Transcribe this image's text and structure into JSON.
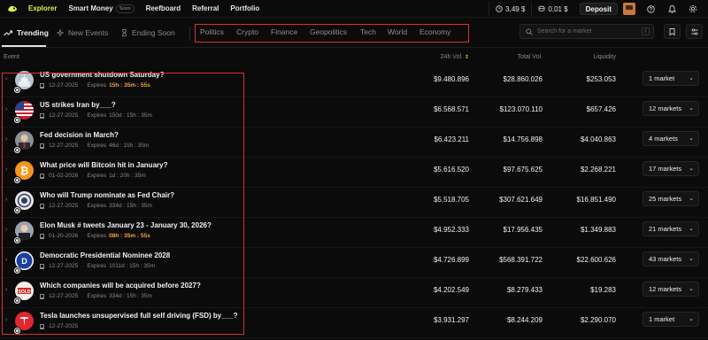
{
  "nav": {
    "links": [
      "Explorer",
      "Smart Money",
      "Reefboard",
      "Referral",
      "Portfolio"
    ],
    "soon_badge": "Soon",
    "balance_1": "3,49 $",
    "balance_2": "0,01 $",
    "deposit_label": "Deposit"
  },
  "tabs": {
    "trending": "Trending",
    "new_events": "New Events",
    "ending_soon": "Ending Soon"
  },
  "categories": [
    "Politics",
    "Crypto",
    "Finance",
    "Geopolitics",
    "Tech",
    "World",
    "Economy"
  ],
  "search": {
    "placeholder": "Search for a market",
    "shortcut": "/"
  },
  "columns": {
    "event": "Event",
    "vol_24h": "24h Vol.",
    "total_vol": "Total Vol.",
    "liquidity": "Liquidity"
  },
  "colors": {
    "accent": "#d7f24a",
    "highlight_box": "#d9312f",
    "expires_hot": "#f2a43a"
  },
  "rows": [
    {
      "title": "US government shutdown Saturday?",
      "date": "12-27-2025",
      "expires": "15h : 35m : 55s",
      "expires_hot": true,
      "vol_24h": "$9.480.896",
      "total_vol": "$28.860.026",
      "liquidity": "$253.053",
      "markets": "1 market",
      "icon": "capitol-icon"
    },
    {
      "title": "US strikes Iran by___?",
      "date": "12-27-2025",
      "expires": "150d : 15h : 35m",
      "expires_hot": false,
      "vol_24h": "$6.568.571",
      "total_vol": "$123.070.110",
      "liquidity": "$657.426",
      "markets": "12 markets",
      "icon": "us-flag-icon"
    },
    {
      "title": "Fed decision in March?",
      "date": "12-27-2025",
      "expires": "46d : 15h : 35m",
      "expires_hot": false,
      "vol_24h": "$6.423.211",
      "total_vol": "$14.756.898",
      "liquidity": "$4.040.863",
      "markets": "4 markets",
      "icon": "fed-chair-icon"
    },
    {
      "title": "What price will Bitcoin hit in January?",
      "date": "01-02-2026",
      "expires": "1d : 20h : 35m",
      "expires_hot": false,
      "vol_24h": "$5.616.520",
      "total_vol": "$97.675.625",
      "liquidity": "$2.268.221",
      "markets": "17 markets",
      "icon": "bitcoin-icon"
    },
    {
      "title": "Who will Trump nominate as Fed Chair?",
      "date": "12-27-2025",
      "expires": "334d : 15h : 35m",
      "expires_hot": false,
      "vol_24h": "$5.518.705",
      "total_vol": "$307.621.649",
      "liquidity": "$16.851.490",
      "markets": "25 markets",
      "icon": "fed-seal-icon"
    },
    {
      "title": "Elon Musk # tweets January 23 - January 30, 2026?",
      "date": "01-20-2026",
      "expires": "08h : 35m : 55s",
      "expires_hot": true,
      "vol_24h": "$4.952.333",
      "total_vol": "$17.956.435",
      "liquidity": "$1.349.883",
      "markets": "21 markets",
      "icon": "elon-musk-icon"
    },
    {
      "title": "Democratic Presidential Nominee 2028",
      "date": "12-27-2025",
      "expires": "1011d : 15h : 35m",
      "expires_hot": false,
      "vol_24h": "$4.726.899",
      "total_vol": "$568.391.722",
      "liquidity": "$22.600.626",
      "markets": "43 markets",
      "icon": "democrat-icon"
    },
    {
      "title": "Which companies will be acquired before 2027?",
      "date": "12-27-2025",
      "expires": "334d : 15h : 35m",
      "expires_hot": false,
      "vol_24h": "$4.202.549",
      "total_vol": "$8.279.433",
      "liquidity": "$19.283",
      "markets": "12 markets",
      "icon": "sold-sign-icon"
    },
    {
      "title": "Tesla launches unsupervised full self driving (FSD) by___?",
      "date": "12-27-2025",
      "expires": "",
      "expires_hot": false,
      "vol_24h": "$3.931.297",
      "total_vol": "$8.244.209",
      "liquidity": "$2.290.070",
      "markets": "1 market",
      "icon": "tesla-icon"
    }
  ]
}
